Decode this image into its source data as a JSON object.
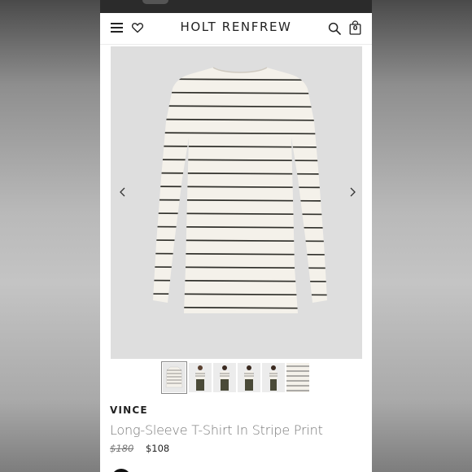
{
  "header": {
    "brand": "HOLT RENFREW",
    "menu_icon": "hamburger-menu-icon",
    "wishlist_icon": "heart-icon",
    "search_icon": "search-icon",
    "bag_icon": "shopping-bag-icon",
    "bag_count": "0"
  },
  "gallery": {
    "prev_icon": "chevron-left-icon",
    "next_icon": "chevron-right-icon",
    "thumbnail_count": 6,
    "active_thumbnail": 1
  },
  "product": {
    "brand": "VINCE",
    "name": "Long-Sleeve T-Shirt In Stripe Print",
    "original_price": "$180",
    "sale_price": "$108"
  },
  "colors": {
    "stripe": "#2f2f2a",
    "fabric": "#f4f1ea",
    "hero_bg": "#dedede"
  }
}
